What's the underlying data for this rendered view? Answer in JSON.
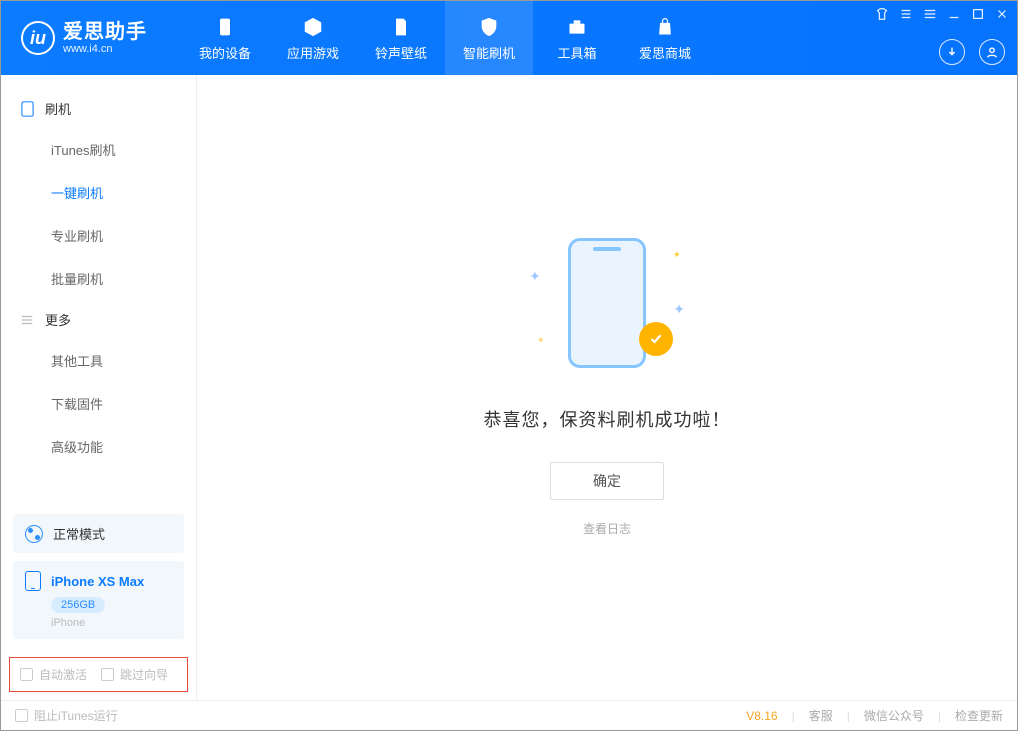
{
  "app": {
    "title": "爱思助手",
    "subtitle": "www.i4.cn"
  },
  "tabs": {
    "device": "我的设备",
    "apps": "应用游戏",
    "ringtones": "铃声壁纸",
    "flash": "智能刷机",
    "tools": "工具箱",
    "store": "爱思商城"
  },
  "sidebar": {
    "group_flash": "刷机",
    "items_flash": {
      "itunes": "iTunes刷机",
      "onekey": "一键刷机",
      "pro": "专业刷机",
      "batch": "批量刷机"
    },
    "group_more": "更多",
    "items_more": {
      "other": "其他工具",
      "firmware": "下载固件",
      "advanced": "高级功能"
    },
    "mode": "正常模式",
    "device_name": "iPhone XS Max",
    "capacity": "256GB",
    "device_type": "iPhone",
    "auto_activate": "自动激活",
    "skip_guide": "跳过向导"
  },
  "main": {
    "success_msg": "恭喜您，保资料刷机成功啦！",
    "ok_btn": "确定",
    "view_log": "查看日志"
  },
  "footer": {
    "block_itunes": "阻止iTunes运行",
    "version": "V8.16",
    "service": "客服",
    "wechat": "微信公众号",
    "update": "检查更新"
  }
}
